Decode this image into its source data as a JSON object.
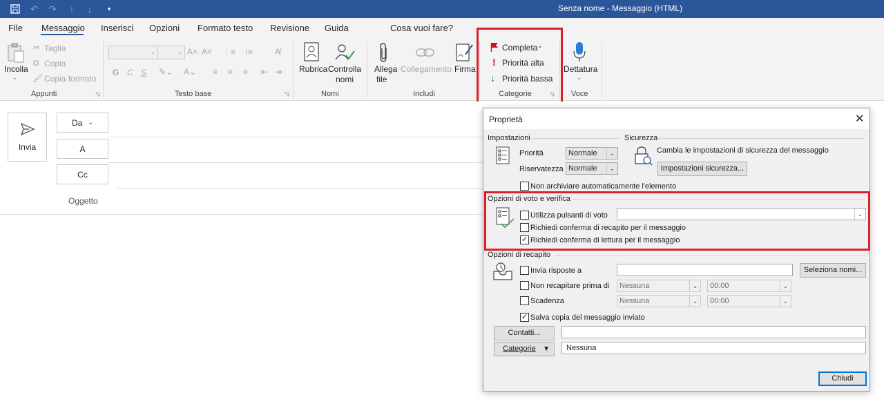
{
  "window": {
    "title": "Senza nome  -  Messaggio (HTML)"
  },
  "tabs": [
    "File",
    "Messaggio",
    "Inserisci",
    "Opzioni",
    "Formato testo",
    "Revisione",
    "Guida",
    "Cosa vuoi fare?"
  ],
  "ribbon": {
    "appunti": {
      "paste": "Incolla",
      "cut": "Taglia",
      "copy": "Copia",
      "format_painter": "Copia formato",
      "label": "Appunti"
    },
    "testo_base": {
      "label": "Testo base",
      "bold": "G",
      "italic": "C",
      "underline": "S"
    },
    "nomi": {
      "address_book": "Rubrica",
      "check_names_1": "Controlla",
      "check_names_2": "nomi",
      "label": "Nomi"
    },
    "includi": {
      "attach_1": "Allega",
      "attach_2": "file",
      "link": "Collegamento",
      "signature": "Firma",
      "label": "Includi"
    },
    "categorie": {
      "followup": "Completa",
      "high": "Priorità alta",
      "low": "Priorità bassa",
      "label": "Categorie"
    },
    "voce": {
      "dictate": "Dettatura",
      "label": "Voce"
    }
  },
  "compose": {
    "send": "Invia",
    "from": "Da",
    "to": "A",
    "cc": "Cc",
    "subject": "Oggetto"
  },
  "dialog": {
    "title": "Proprietà",
    "settings_header": "Impostazioni",
    "security_header": "Sicurezza",
    "priority_label": "Priorità",
    "priority_value": "Normale",
    "sensitivity_label": "Riservatezza",
    "sensitivity_value": "Normale",
    "security_text": "Cambia le impostazioni di sicurezza del messaggio",
    "security_button": "Impostazioni sicurezza...",
    "no_autoarchive": "Non archiviare automaticamente l'elemento",
    "voting_header": "Opzioni di voto e verifica",
    "use_voting": "Utilizza pulsanti di voto",
    "delivery_receipt": "Richiedi conferma di recapito per il messaggio",
    "read_receipt": "Richiedi conferma di lettura per il messaggio",
    "delivery_header": "Opzioni di recapito",
    "reply_to": "Invia risposte a",
    "select_names": "Seleziona nomi...",
    "do_not_deliver": "Non recapitare prima di",
    "expires": "Scadenza",
    "date_none": "Nessuna",
    "time_zero": "00:00",
    "save_copy": "Salva copia del messaggio inviato",
    "contacts_button": "Contatti...",
    "categories_button": "Categorie",
    "categories_value": "Nessuna",
    "close_button": "Chiudi"
  },
  "checkboxes": {
    "no_autoarchive": false,
    "use_voting": false,
    "delivery_receipt": false,
    "read_receipt": true,
    "reply_to": false,
    "do_not_deliver": false,
    "expires": false,
    "save_copy": true
  },
  "colors": {
    "title_bar": "#2b579a",
    "highlight": "#d9212d",
    "flag": "#c4161c"
  }
}
